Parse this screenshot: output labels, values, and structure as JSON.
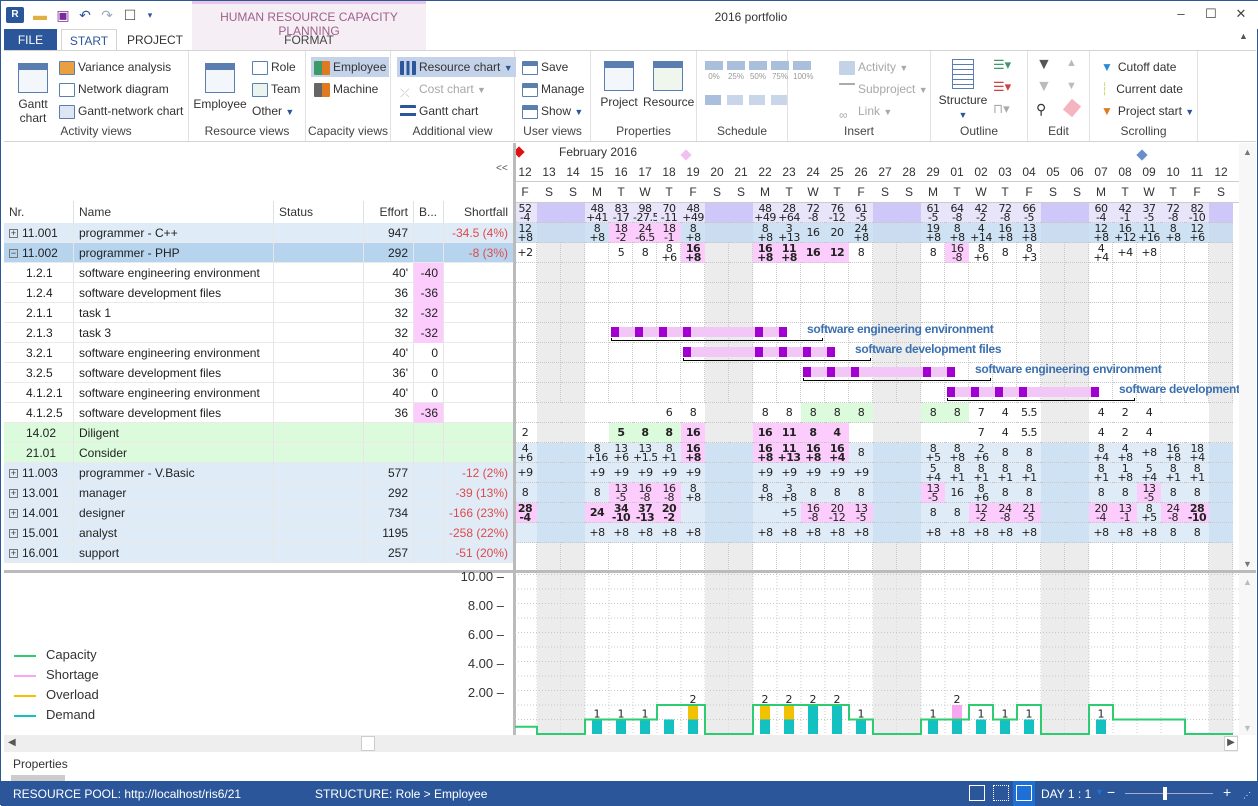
{
  "app": {
    "window_title": "2016 portfolio",
    "context_tab_title": "HUMAN RESOURCE CAPACITY PLANNING",
    "quick_access": [
      "app-logo-icon",
      "open-folder-icon",
      "save-icon",
      "undo-icon",
      "redo-icon",
      "window-icon",
      "customize-dropdown-icon"
    ],
    "window_buttons": {
      "minimize": "–",
      "maximize": "☐",
      "close": "✕"
    }
  },
  "tabs": [
    {
      "label": "FILE"
    },
    {
      "label": "START",
      "active": true
    },
    {
      "label": "PROJECT"
    },
    {
      "label": "FORMAT"
    }
  ],
  "ribbon": {
    "activity_views": {
      "label": "Activity views",
      "gantt": "Gantt chart",
      "gantt_l1": "Gantt",
      "gantt_l2": "chart",
      "variance": "Variance analysis",
      "network": "Network diagram",
      "gantt_network": "Gantt-network chart"
    },
    "resource_views": {
      "label": "Resource views",
      "employee": "Employee",
      "role": "Role",
      "team": "Team",
      "other": "Other"
    },
    "capacity_views": {
      "label": "Capacity views",
      "employee": "Employee",
      "machine": "Machine"
    },
    "additional_view": {
      "label": "Additional view",
      "resource_chart": "Resource chart",
      "cost_chart": "Cost chart",
      "gantt_chart": "Gantt chart"
    },
    "user_views": {
      "label": "User views",
      "save": "Save",
      "manage": "Manage",
      "show": "Show"
    },
    "properties": {
      "label": "Properties",
      "project": "Project",
      "resource": "Resource"
    },
    "schedule": {
      "label": "Schedule",
      "progress": [
        "0%",
        "25%",
        "50%",
        "75%",
        "100%"
      ]
    },
    "insert": {
      "label": "Insert",
      "activity": "Activity",
      "subproject": "Subproject",
      "link": "Link"
    },
    "outline": {
      "label": "Outline",
      "structure": "Structure"
    },
    "edit": {
      "label": "Edit"
    },
    "scrolling": {
      "label": "Scrolling",
      "cutoff": "Cutoff date",
      "current": "Current date",
      "project_start": "Project start"
    }
  },
  "table": {
    "collapse_label": "<<",
    "columns": [
      "Nr.",
      "Name",
      "Status",
      "Effort",
      "B...",
      "Shortfall"
    ],
    "rows": [
      {
        "nr": "11.001",
        "name": "programmer - C++",
        "status": "",
        "effort": "947",
        "b": "",
        "shortfall": "-34.5 (4%)",
        "type": "group",
        "expand": "+"
      },
      {
        "nr": "11.002",
        "name": "programmer - PHP",
        "status": "",
        "effort": "292",
        "b": "",
        "shortfall": "-8 (3%)",
        "type": "selected",
        "expand": "−"
      },
      {
        "nr": "1.2.1",
        "name": "software engineering environment",
        "status": "",
        "effort": "40'",
        "b": "-40",
        "shortfall": "",
        "type": "task",
        "bpink": true
      },
      {
        "nr": "1.2.4",
        "name": "software development files",
        "status": "",
        "effort": "36",
        "b": "-36",
        "shortfall": "",
        "type": "task",
        "bpink": true
      },
      {
        "nr": "2.1.1",
        "name": "task 1",
        "status": "",
        "effort": "32",
        "b": "-32",
        "shortfall": "",
        "type": "task",
        "bpink": true
      },
      {
        "nr": "2.1.3",
        "name": "task 3",
        "status": "",
        "effort": "32",
        "b": "-32",
        "shortfall": "",
        "type": "task",
        "bpink": true
      },
      {
        "nr": "3.2.1",
        "name": "software engineering environment",
        "status": "",
        "effort": "40'",
        "b": "0",
        "shortfall": "",
        "type": "task"
      },
      {
        "nr": "3.2.5",
        "name": "software development files",
        "status": "",
        "effort": "36'",
        "b": "0",
        "shortfall": "",
        "type": "task"
      },
      {
        "nr": "4.1.2.1",
        "name": "software engineering environment",
        "status": "",
        "effort": "40'",
        "b": "0",
        "shortfall": "",
        "type": "task"
      },
      {
        "nr": "4.1.2.5",
        "name": "software development files",
        "status": "",
        "effort": "36",
        "b": "-36",
        "shortfall": "",
        "type": "task",
        "bpink": true
      },
      {
        "nr": "14.02",
        "name": "Diligent",
        "status": "",
        "effort": "",
        "b": "",
        "shortfall": "",
        "type": "green"
      },
      {
        "nr": "21.01",
        "name": "Consider",
        "status": "",
        "effort": "",
        "b": "",
        "shortfall": "",
        "type": "green"
      },
      {
        "nr": "11.003",
        "name": "programmer - V.Basic",
        "status": "",
        "effort": "577",
        "b": "",
        "shortfall": "-12 (2%)",
        "type": "group",
        "expand": "+"
      },
      {
        "nr": "13.001",
        "name": "manager",
        "status": "",
        "effort": "292",
        "b": "",
        "shortfall": "-39 (13%)",
        "type": "group",
        "expand": "+"
      },
      {
        "nr": "14.001",
        "name": "designer",
        "status": "",
        "effort": "734",
        "b": "",
        "shortfall": "-166 (23%)",
        "type": "group",
        "expand": "+"
      },
      {
        "nr": "15.001",
        "name": "analyst",
        "status": "",
        "effort": "1195",
        "b": "",
        "shortfall": "-258 (22%)",
        "type": "group",
        "expand": "+"
      },
      {
        "nr": "16.001",
        "name": "support",
        "status": "",
        "effort": "257",
        "b": "",
        "shortfall": "-51 (20%)",
        "type": "group",
        "expand": "+"
      }
    ]
  },
  "timeline": {
    "month_label": "February 2016",
    "days": [
      {
        "d": "12",
        "w": "F"
      },
      {
        "d": "13",
        "w": "S"
      },
      {
        "d": "14",
        "w": "S"
      },
      {
        "d": "15",
        "w": "M"
      },
      {
        "d": "16",
        "w": "T"
      },
      {
        "d": "17",
        "w": "W"
      },
      {
        "d": "18",
        "w": "T"
      },
      {
        "d": "19",
        "w": "F"
      },
      {
        "d": "20",
        "w": "S"
      },
      {
        "d": "21",
        "w": "S"
      },
      {
        "d": "22",
        "w": "M"
      },
      {
        "d": "23",
        "w": "T"
      },
      {
        "d": "24",
        "w": "W"
      },
      {
        "d": "25",
        "w": "T"
      },
      {
        "d": "26",
        "w": "F"
      },
      {
        "d": "27",
        "w": "S"
      },
      {
        "d": "28",
        "w": "S"
      },
      {
        "d": "29",
        "w": "M"
      },
      {
        "d": "01",
        "w": "T"
      },
      {
        "d": "02",
        "w": "W"
      },
      {
        "d": "03",
        "w": "T"
      },
      {
        "d": "04",
        "w": "F"
      },
      {
        "d": "05",
        "w": "S"
      },
      {
        "d": "06",
        "w": "S"
      },
      {
        "d": "07",
        "w": "M"
      },
      {
        "d": "08",
        "w": "T"
      },
      {
        "d": "09",
        "w": "W"
      },
      {
        "d": "10",
        "w": "T"
      },
      {
        "d": "11",
        "w": "F"
      },
      {
        "d": "12",
        "w": "S"
      }
    ],
    "cells": [
      [
        "52|-4",
        "",
        "",
        "48|+41",
        "83|-17",
        "98|-27.5",
        "70|-11",
        "48|+49",
        "",
        "",
        "48|+49",
        "28|+64",
        "72|-8",
        "76|-12",
        "61|-5",
        "",
        "",
        "61|-5",
        "64|-8",
        "42|-2",
        "72|-8",
        "66|-5",
        "",
        "",
        "60|-4",
        "42|-1",
        "37|-5",
        "72|-8",
        "82|-10",
        ""
      ],
      [
        "12|+8",
        "",
        "",
        "8|+8",
        "18|-2*",
        "24|-6.5*",
        "18|-1*",
        "8|+8",
        "",
        "",
        "8|+8",
        "3|+13",
        "16",
        "20",
        "24|+8",
        "",
        "",
        "19|+8",
        "8|+8",
        "4|+14",
        "16|+8",
        "13|+8",
        "",
        "",
        "12|+8",
        "16|+12",
        "11|+16",
        "8|+8",
        "12|+6",
        ""
      ],
      [
        "+2",
        "",
        "",
        "",
        "5",
        "8",
        "8|+6",
        "16|+8*B",
        "",
        "",
        "16|+8*B",
        "11|+8*B",
        "16*B",
        "12*B",
        "8",
        "",
        "",
        "8",
        "16|-8*",
        "8|+6",
        "8",
        "8|+3",
        "",
        "",
        "4|+4",
        "+4",
        "+8",
        "",
        "",
        ""
      ],
      [],
      [],
      [],
      [],
      [],
      [],
      [],
      [
        "",
        "",
        "",
        "",
        "",
        "",
        "6",
        "8",
        "",
        "",
        "8",
        "8",
        "8g",
        "8g",
        "8g",
        "",
        "",
        "8g",
        "8g",
        "7",
        "4",
        "5.5",
        "",
        "",
        "4",
        "2",
        "4",
        "",
        "",
        ""
      ],
      [
        "2",
        "",
        "",
        "",
        "5gB",
        "8gB",
        "8gB",
        "16*B",
        "",
        "",
        "16*B",
        "11*B",
        "8*B",
        "4*B",
        "",
        "",
        "",
        "",
        "",
        "7",
        "4",
        "5.5",
        "",
        "",
        "4",
        "2",
        "4",
        "",
        "",
        ""
      ],
      [
        "4|+6",
        "",
        "",
        "8|+16",
        "13|+6",
        "13|+1.5",
        "8|+1",
        "16|+8*B",
        "",
        "",
        "16|+8*B",
        "11|+13*B",
        "16|+8*B",
        "16|+4*B",
        "8",
        "",
        "",
        "8|+5",
        "8|+8",
        "2|+6",
        "8",
        "8",
        "",
        "",
        "8|+4",
        "4|+8",
        "+8",
        "16|+8",
        "18|+4",
        ""
      ],
      [
        "+9",
        "",
        "",
        "+9",
        "+9",
        "+9",
        "+9",
        "+9",
        "",
        "",
        "+9",
        "+9",
        "+9",
        "+9",
        "+9",
        "",
        "",
        "5|+4",
        "8|+1",
        "8|+1",
        "8|+1",
        "8|+1",
        "",
        "",
        "8|+1",
        "1|+8",
        "5|+4",
        "8|+1",
        "8|+1",
        ""
      ],
      [
        "8",
        "",
        "",
        "8",
        "13|-5*",
        "16|-8*",
        "16|-8*",
        "8|+8",
        "",
        "",
        "8|+8",
        "3|+8",
        "8",
        "8",
        "8",
        "",
        "",
        "13|-5*",
        "16",
        "8|+6",
        "8",
        "8",
        "",
        "",
        "8",
        "8",
        "13|-5*",
        "8",
        "8",
        ""
      ],
      [
        "28|-4*B",
        "",
        "",
        "24*B",
        "34|-10*B",
        "37|-13*B",
        "20|-2*B",
        "",
        "",
        "",
        "",
        "+5",
        "16|-8*",
        "20|-12*",
        "13|-5*",
        "",
        "",
        "8",
        "8",
        "12|-2*",
        "24|-8*",
        "21|-5*",
        "",
        "",
        "20|-4*",
        "13|-1*",
        "8|+5",
        "24|-8*",
        "28|-10*B",
        ""
      ],
      [
        "",
        "",
        "",
        "+8",
        "+8",
        "+8",
        "+8",
        "+8",
        "",
        "",
        "+8",
        "+8",
        "+8",
        "+8",
        "+8",
        "",
        "",
        "+8",
        "+8",
        "+8",
        "+8",
        "+8",
        "",
        "",
        "+8",
        "+8",
        "+8",
        "8",
        "8",
        ""
      ]
    ],
    "gantt_bars": [
      {
        "row": 6,
        "start": 4,
        "end": 11,
        "label": "software engineering environment",
        "marks": [
          4,
          5,
          6,
          7,
          10,
          11
        ]
      },
      {
        "row": 7,
        "start": 7,
        "end": 13,
        "label": "software development files",
        "marks": [
          7,
          10,
          11,
          12,
          13
        ]
      },
      {
        "row": 8,
        "start": 12,
        "end": 18,
        "label": "software engineering environment",
        "marks": [
          12,
          13,
          14,
          17,
          18
        ]
      },
      {
        "row": 9,
        "start": 18,
        "end": 24,
        "label": "software development files",
        "marks": [
          18,
          19,
          20,
          21,
          24
        ]
      }
    ]
  },
  "chart_data": {
    "type": "bar",
    "title": "",
    "xlabel": "",
    "ylabel": "",
    "ylim": [
      0,
      11
    ],
    "y_ticks": [
      "10.00",
      "8.00",
      "6.00",
      "4.00",
      "2.00"
    ],
    "legend": [
      {
        "name": "Capacity",
        "color": "#2ecc71"
      },
      {
        "name": "Shortage",
        "color": "#f7a6f2"
      },
      {
        "name": "Overload",
        "color": "#f2c200"
      },
      {
        "name": "Demand",
        "color": "#14c1c1"
      }
    ],
    "legend_placement": "left",
    "categories": [
      "12",
      "13",
      "14",
      "15",
      "16",
      "17",
      "18",
      "19",
      "20",
      "21",
      "22",
      "23",
      "24",
      "25",
      "26",
      "27",
      "28",
      "29",
      "01",
      "02",
      "03",
      "04",
      "05",
      "06",
      "07",
      "08",
      "09",
      "10",
      "11",
      "12"
    ],
    "capacity": [
      0.5,
      0,
      0,
      1,
      1,
      1,
      2,
      2,
      0,
      0,
      2,
      2,
      2,
      2,
      1,
      0,
      0,
      1,
      1,
      2,
      1,
      2,
      0,
      0,
      2,
      1,
      1,
      1,
      0,
      0
    ],
    "demand": [
      0,
      0,
      0,
      1,
      1,
      1,
      1,
      1,
      0,
      0,
      1,
      1,
      2,
      2,
      1,
      0,
      0,
      1,
      1,
      1,
      1,
      1,
      0,
      0,
      1,
      0,
      0,
      0,
      0,
      0
    ],
    "overload": [
      0,
      0,
      0,
      0,
      0,
      0,
      0,
      1,
      0,
      0,
      1,
      1,
      0,
      0,
      0,
      0,
      0,
      0,
      0,
      0,
      0,
      0,
      0,
      0,
      0,
      0,
      0,
      0,
      0,
      0
    ],
    "shortage": [
      0,
      0,
      0,
      0,
      0,
      0,
      0,
      0,
      0,
      0,
      0,
      0,
      0,
      0,
      0,
      0,
      0,
      0,
      1,
      0,
      0,
      0,
      0,
      0,
      0,
      0,
      0,
      0,
      0,
      0
    ],
    "labels": [
      "",
      "",
      "",
      "1",
      "1",
      "1",
      "",
      "2",
      "",
      "",
      "2",
      "2",
      "2",
      "2",
      "1",
      "",
      "",
      "1",
      "2",
      "1",
      "1",
      "1",
      "",
      "",
      "1",
      "",
      "",
      "",
      "",
      ""
    ]
  },
  "properties_label": "Properties",
  "status": {
    "resource_pool": "RESOURCE POOL: http://localhost/ris6/21",
    "structure": "STRUCTURE: Role > Employee",
    "zoom_level": "DAY 1 : 1",
    "zoom_slider_fraction": 0.45
  }
}
